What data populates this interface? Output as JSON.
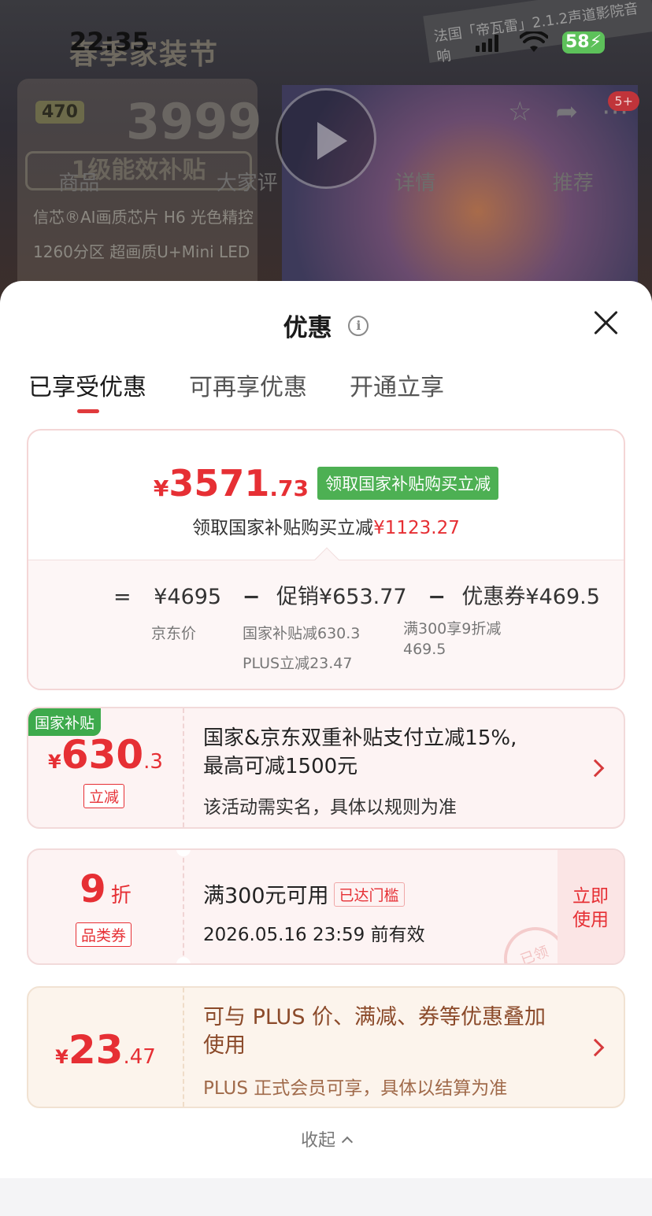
{
  "status_bar": {
    "time": "22:35",
    "battery": "58"
  },
  "background": {
    "banner_title": "春季家装节",
    "price": "3999",
    "mini_tag": "470",
    "subsidy_box": "1级能效补贴",
    "features": [
      "信芯®AI画质芯片 H6 光色精控",
      "1260分区 超画质U+Mini LED"
    ],
    "top_strip": "法国「帝瓦雷」2.1.2声道影院音响",
    "nav_tabs": [
      "商品",
      "大家评",
      "详情",
      "推荐"
    ],
    "badge": "5+"
  },
  "sheet": {
    "title": "优惠",
    "info_symbol": "i",
    "tabs": [
      "已享受优惠",
      "可再享优惠",
      "开通立享"
    ],
    "summary": {
      "currency": "¥",
      "price_int": "3571",
      "price_dec": ".73",
      "green_tag": "领取国家补贴购买立减",
      "sub_text": "领取国家补贴购买立减",
      "sub_amount": "¥1123.27",
      "eq_sign": "=",
      "jd_price": "¥4695",
      "minus": "−",
      "promo": "促销¥653.77",
      "coupon": "优惠券¥469.5",
      "jd_label": "京东价",
      "promo_detail_1": "国家补贴减630.3",
      "promo_detail_2": "PLUS立减23.47",
      "coupon_detail_1": "满300享9折减",
      "coupon_detail_2": "469.5"
    },
    "card_subsidy": {
      "corner": "国家补贴",
      "currency": "¥",
      "int": "630",
      "dec": ".3",
      "tag": "立减",
      "line1a": "国家&京东双重补贴支付立减15%,",
      "line1b": "最高可减1500元",
      "line2": "该活动需实名，具体以规则为准"
    },
    "card_coupon": {
      "number": "9",
      "unit": "折",
      "tag": "品类券",
      "line1": "满300元可用",
      "threshold_tag": "已达门槛",
      "line2": "2026.05.16 23:59 前有效",
      "use_line1": "立即",
      "use_line2": "使用",
      "stamp": "已领"
    },
    "card_plus": {
      "currency": "¥",
      "int": "23",
      "dec": ".47",
      "line1a": "可与 PLUS 价、满减、券等优惠叠加",
      "line1b": "使用",
      "line2": "PLUS 正式会员可享，具体以结算为准"
    },
    "collapse_label": "收起"
  }
}
